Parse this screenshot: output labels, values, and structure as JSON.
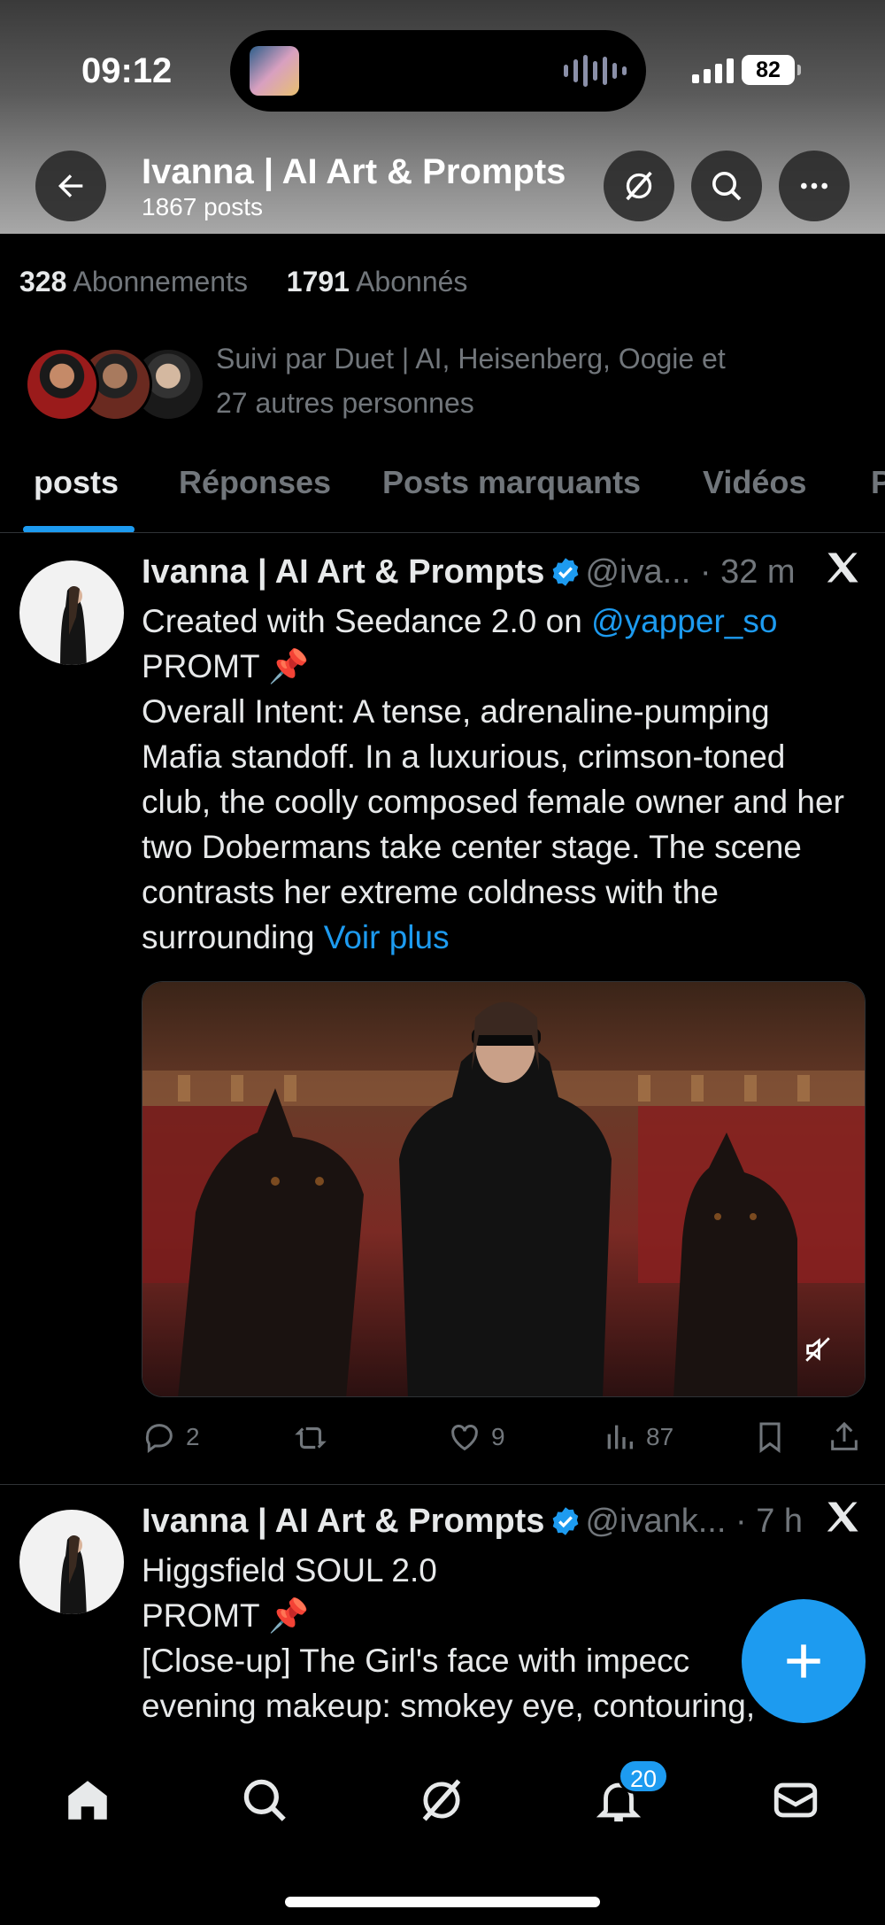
{
  "status_bar": {
    "time": "09:12",
    "battery": "82"
  },
  "header": {
    "title": "Ivanna | AI Art & Prompts",
    "subtitle": "1867 posts"
  },
  "profile": {
    "following_count": "328",
    "following_label": "Abonnements",
    "followers_count": "1791",
    "followers_label": "Abonnés",
    "followed_by_line1": "Suivi par Duet | AI, Heisenberg, Oogie et",
    "followed_by_line2": "27 autres personnes"
  },
  "tabs": [
    {
      "label": "posts",
      "active": true
    },
    {
      "label": "Réponses",
      "active": false
    },
    {
      "label": "Posts marquants",
      "active": false
    },
    {
      "label": "Vidéos",
      "active": false
    },
    {
      "label": "P",
      "active": false
    }
  ],
  "tweets": [
    {
      "name": "Ivanna | AI Art & Prompts",
      "handle": "@iva...",
      "sep": "·",
      "time": "32 m",
      "line1_pre": "Created with Seedance 2.0 on ",
      "mention": "@yapper_so",
      "line2": "PROMT 📌",
      "body": "Overall Intent: A tense, adrenaline-pumping Mafia standoff. In a luxurious, crimson-toned club, the coolly composed female owner and her two Dobermans take center stage. The scene contrasts her extreme coldness with the surrounding ",
      "see_more": "Voir plus",
      "replies": "2",
      "reposts": "",
      "likes": "9",
      "views": "87"
    },
    {
      "name": "Ivanna | AI Art & Prompts",
      "handle": "@ivank...",
      "sep": "·",
      "time": "7 h",
      "line1": "Higgsfield SOUL 2.0",
      "line2": "PROMT 📌",
      "line3": "[Close-up] The Girl's face with impecc",
      "line4": "evening makeup: smokey eye, contouring,"
    }
  ],
  "bottom_nav": {
    "notifications_badge": "20"
  },
  "colors": {
    "accent": "#1d9bf0",
    "background": "#000000",
    "muted_text": "#71767b"
  },
  "icons": [
    "back-arrow-icon",
    "grok-icon",
    "search-icon",
    "more-icon",
    "verified-icon",
    "x-logo-icon",
    "reply-icon",
    "repost-icon",
    "like-icon",
    "views-icon",
    "bookmark-icon",
    "share-icon",
    "mute-icon",
    "plus-icon",
    "home-icon",
    "notifications-icon",
    "messages-icon"
  ]
}
